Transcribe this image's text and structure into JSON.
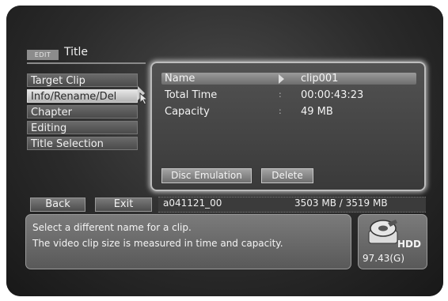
{
  "header": {
    "tag": "EDIT",
    "title": "Title"
  },
  "menu": {
    "items": [
      {
        "label": "Target Clip",
        "selected": false
      },
      {
        "label": "Info/Rename/Del",
        "selected": true
      },
      {
        "label": "Chapter",
        "selected": false
      },
      {
        "label": "Editing",
        "selected": false
      },
      {
        "label": "Title Selection",
        "selected": false
      }
    ]
  },
  "info": {
    "name_label": "Name",
    "name_value": "clip001",
    "time_label": "Total Time",
    "time_value": "00:00:43:23",
    "capacity_label": "Capacity",
    "capacity_value": "49 MB",
    "disc_emulation_label": "Disc Emulation",
    "delete_label": "Delete"
  },
  "bottom": {
    "back_label": "Back",
    "exit_label": "Exit",
    "clip_id": "a041121_00",
    "capacity": "3503 MB / 3519 MB"
  },
  "message": {
    "line1": "Select a different name for a clip.",
    "line2": "The video clip size is measured in time and capacity."
  },
  "hdd": {
    "label": "HDD",
    "free": "97.43(G)",
    "icon": "hard-disk-icon"
  }
}
